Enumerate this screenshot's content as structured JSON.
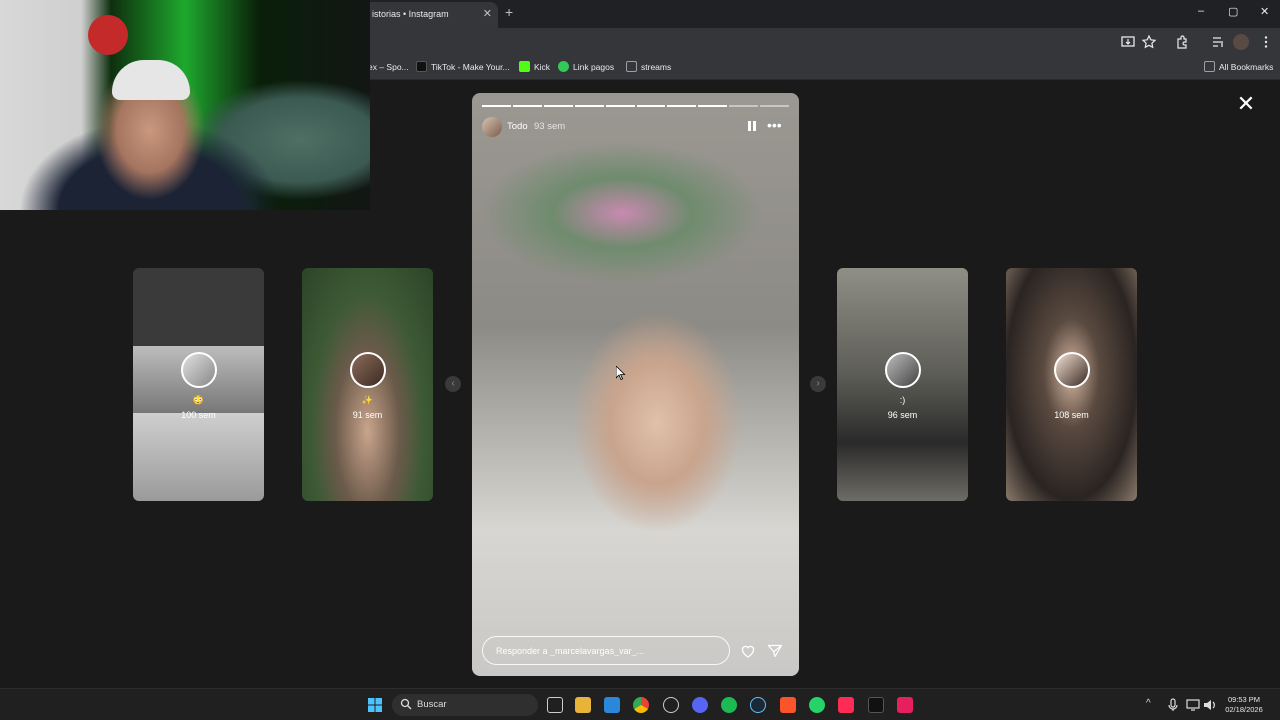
{
  "browser": {
    "tab_title": "istorias • Instagram",
    "tab_close": "✕",
    "new_tab": "+",
    "window_controls": [
      "–",
      "▢",
      "✕"
    ],
    "bookmarks": [
      {
        "label": "ex – Spo...",
        "color": "#1db954"
      },
      {
        "label": "TikTok - Make Your...",
        "color": "#111111"
      },
      {
        "label": "Kick",
        "color": "#53fc18"
      },
      {
        "label": "Link pagos",
        "color": "#34c759"
      },
      {
        "label": "streams",
        "color": "#9aa0a6"
      }
    ],
    "all_bookmarks": "All Bookmarks"
  },
  "viewer": {
    "close": "✕",
    "side_stories": [
      {
        "username": "",
        "emoji": "😳",
        "time": "100 sem"
      },
      {
        "username": "✨",
        "time": "91 sem"
      },
      {
        "username": ":)",
        "time": "96 sem"
      },
      {
        "username": "",
        "time": "108 sem"
      }
    ],
    "prev": "‹",
    "next": "›"
  },
  "story": {
    "username": "Todo",
    "time": "93 sem",
    "progress": {
      "segments": 10,
      "completed": 8
    },
    "more": "•••",
    "reply_placeholder": "Responder a _marcelavargas_var_..."
  },
  "taskbar": {
    "search_label": "Buscar",
    "time": "09:53 PM",
    "date": "02/18/2026",
    "tray_up": "^",
    "app_colors": {
      "windows": "#4cc2ff",
      "files": "#e8b339",
      "store": "#2b88d8",
      "chrome": "#ea4335",
      "discord": "#5865f2",
      "spotify": "#1db954",
      "steam": "#1b2838",
      "brave": "#fb542b",
      "whatsapp": "#25d366",
      "tiktok": "#fe2c55",
      "capcut": "#111111",
      "adobe": "#e61f5f"
    }
  }
}
